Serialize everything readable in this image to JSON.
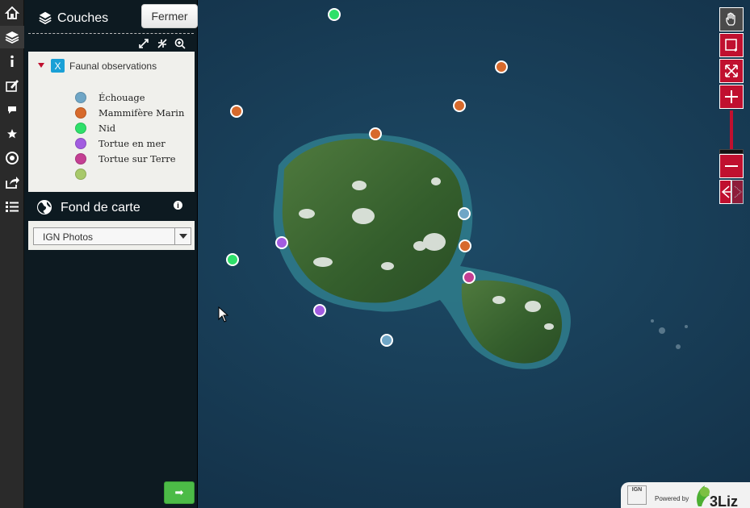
{
  "sidebar": {
    "icons": [
      "home-icon",
      "layers-icon",
      "info-icon",
      "edit-icon",
      "comment-icon",
      "star-icon",
      "locate-icon",
      "share-icon",
      "list-icon"
    ]
  },
  "layers_panel": {
    "title": "Couches",
    "close_label": "Fermer",
    "layer": {
      "name": "Faunal observations",
      "checked_mark": "X",
      "legend": [
        {
          "label": "Échouage",
          "color": "#6fa6c6"
        },
        {
          "label": "Mammifère Marin",
          "color": "#d76a2c"
        },
        {
          "label": "Nid",
          "color": "#2ee06a"
        },
        {
          "label": "Tortue en mer",
          "color": "#a25ce0"
        },
        {
          "label": "Tortue sur Terre",
          "color": "#c43f93"
        },
        {
          "label": "",
          "color": "#a8c96a"
        }
      ]
    }
  },
  "basemap": {
    "title": "Fond de carte",
    "info_glyph": "i",
    "selected": "IGN Photos"
  },
  "go_button": {
    "glyph": "➡"
  },
  "attribution": {
    "ign": "IGN",
    "powered_by": "Powered by",
    "brand": "3Liz"
  },
  "map_markers": [
    {
      "type": "Nid"
    },
    {
      "type": "Mammifère Marin"
    },
    {
      "type": "Mammifère Marin"
    },
    {
      "type": "Mammifère Marin"
    },
    {
      "type": "Mammifère Marin"
    },
    {
      "type": "Échouage"
    },
    {
      "type": "Mammifère Marin"
    },
    {
      "type": "Tortue en mer"
    },
    {
      "type": "Nid"
    },
    {
      "type": "Tortue sur Terre"
    },
    {
      "type": "Tortue en mer"
    },
    {
      "type": "Échouage"
    }
  ]
}
